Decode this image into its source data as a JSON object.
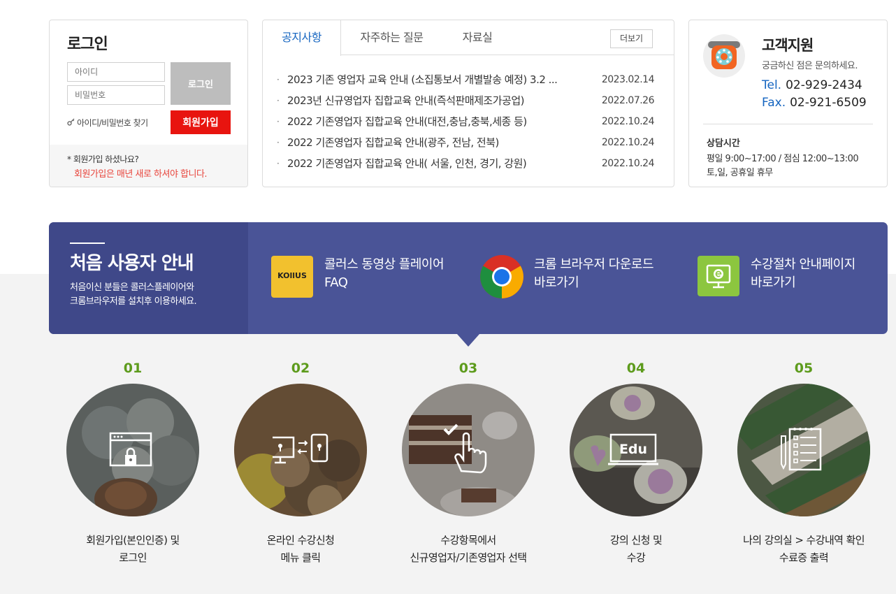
{
  "login": {
    "title": "로그인",
    "id_placeholder": "아이디",
    "pw_placeholder": "비밀번호",
    "login_button": "로그인",
    "find_link": "아이디/비밀번호 찾기",
    "join_button": "회원가입",
    "question": "* 회원가입 하셨나요?",
    "warning": "회원가입은 매년 새로 하셔야 합니다."
  },
  "notice": {
    "tabs": [
      "공지사항",
      "자주하는 질문",
      "자료실"
    ],
    "more": "더보기",
    "items": [
      {
        "title": "2023 기존 영업자 교육 안내 (소집통보서 개별발송 예정) 3.2 ...",
        "date": "2023.02.14"
      },
      {
        "title": "2023년 신규영업자 집합교육 안내(즉석판매제조가공업)",
        "date": "2022.07.26"
      },
      {
        "title": "2022 기존영업자 집합교육 안내(대전,충남,충북,세종 등)",
        "date": "2022.10.24"
      },
      {
        "title": "2022 기존영업자 집합교육 안내(광주, 전남, 전북)",
        "date": "2022.10.24"
      },
      {
        "title": "2022 기존영업자 집합교육 안내( 서울, 인천, 경기, 강원)",
        "date": "2022.10.24"
      }
    ]
  },
  "support": {
    "title": "고객지원",
    "desc": "궁금하신 점은 문의하세요.",
    "tel_label": "Tel.",
    "tel": "02-929-2434",
    "fax_label": "Fax.",
    "fax": "02-921-6509",
    "hours_title": "상담시간",
    "hours_1": "평일 9:00~17:00 / 점심 12:00~13:00",
    "hours_2": "토,일, 공휴일 휴무"
  },
  "guide": {
    "title": "처음 사용자 안내",
    "desc_1": "처음이신 분들은 콜러스플레이어와",
    "desc_2": "크롬브라우저를 설치후 이용하세요.",
    "kollus_logo": "KOllUS",
    "items": [
      {
        "line1": "콜러스 동영상 플레이어",
        "line2": "FAQ",
        "icon": "kollus-icon"
      },
      {
        "line1": "크롬 브라우저 다운로드",
        "line2": "바로가기",
        "icon": "chrome-icon"
      },
      {
        "line1": "수강절차 안내페이지",
        "line2": "바로가기",
        "icon": "e-monitor-icon"
      }
    ]
  },
  "steps": [
    {
      "num": "01",
      "line1": "회원가입(본인인증) 및",
      "line2": "로그인",
      "icon": "browser-lock-icon"
    },
    {
      "num": "02",
      "line1": "온라인 수강신청",
      "line2": "메뉴 클릭",
      "icon": "monitor-phone-icon"
    },
    {
      "num": "03",
      "line1": "수강항목에서",
      "line2": "신규영업자/기존영업자 선택",
      "icon": "hand-check-icon"
    },
    {
      "num": "04",
      "line1": "강의 신청 및",
      "line2": "수강",
      "icon": "edu-monitor-icon"
    },
    {
      "num": "05",
      "line1": "나의 강의실 > 수강내역 확인",
      "line2": "수료증 출력",
      "icon": "notepad-icon"
    }
  ],
  "colors": {
    "accent_blue": "#1565c0",
    "join_red": "#e8140f",
    "warning_red": "#e8453c",
    "banner": "#4a5497",
    "banner_left": "#3f4889",
    "step_green": "#5d9b1c"
  }
}
